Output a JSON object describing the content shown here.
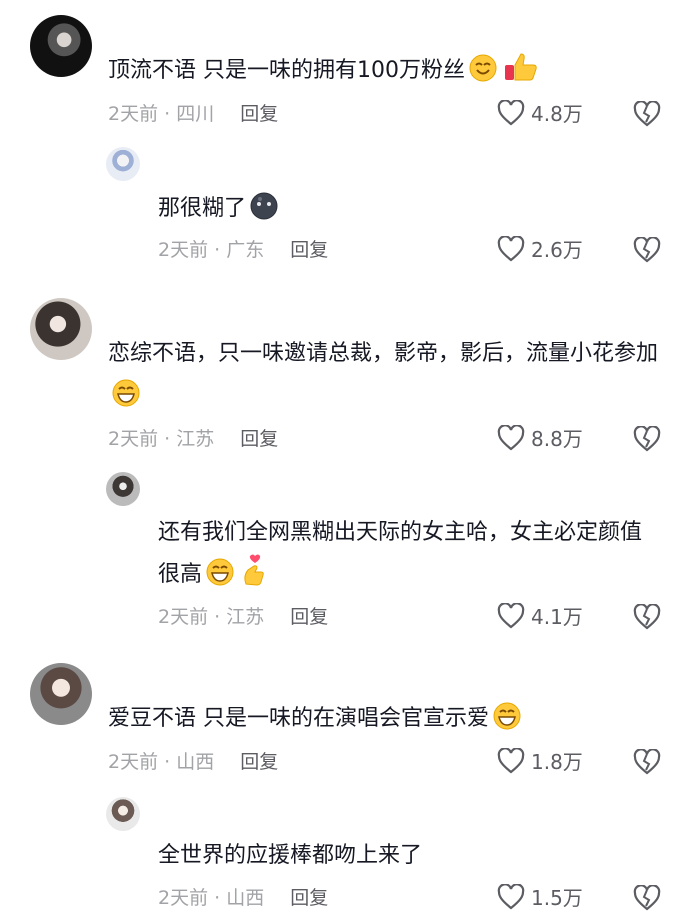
{
  "comments": [
    {
      "text": "顶流不语 只是一味的拥有100万粉丝",
      "time": "2天前",
      "location": "四川",
      "reply_label": "回复",
      "likes": "4.8万",
      "emojis": [
        "smile-emoji-icon",
        "thumbs-up-emoji-icon"
      ]
    },
    {
      "text": "那很糊了",
      "time": "2天前",
      "location": "广东",
      "reply_label": "回复",
      "likes": "2.6万",
      "emojis": [
        "dark-face-emoji-icon"
      ]
    },
    {
      "text": "恋综不语，只一味邀请总裁，影帝，影后，流量小花参加",
      "time": "2天前",
      "location": "江苏",
      "reply_label": "回复",
      "likes": "8.8万",
      "emojis": [
        "grin-emoji-icon"
      ]
    },
    {
      "text": "还有我们全网黑糊出天际的女主哈，女主必定颜值很高",
      "time": "2天前",
      "location": "江苏",
      "reply_label": "回复",
      "likes": "4.1万",
      "emojis": [
        "grin-emoji-icon",
        "finger-heart-emoji-icon"
      ]
    },
    {
      "text": "爱豆不语 只是一味的在演唱会官宣示爱",
      "time": "2天前",
      "location": "山西",
      "reply_label": "回复",
      "likes": "1.8万",
      "emojis": [
        "grin-emoji-icon"
      ]
    },
    {
      "text": "全世界的应援棒都吻上来了",
      "time": "2天前",
      "location": "山西",
      "reply_label": "回复",
      "likes": "1.5万",
      "emojis": []
    }
  ],
  "meta_separator": "·",
  "colors": {
    "text": "#161823",
    "meta": "#a2a3a7",
    "action": "#5c5d63"
  }
}
